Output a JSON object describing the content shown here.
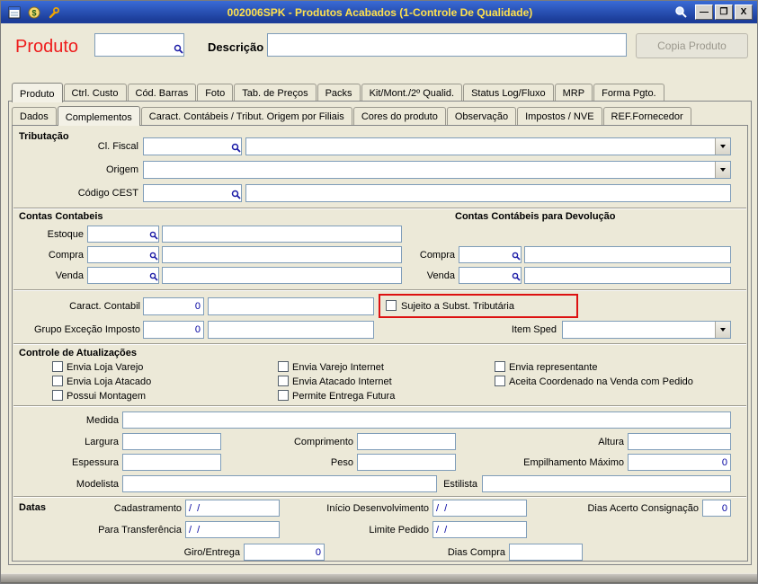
{
  "window": {
    "title": "002006SPK - Produtos Acabados (1-Controle De Qualidade)",
    "controls": {
      "minimize": "—",
      "maximize": "❐",
      "close": "X"
    }
  },
  "colors": {
    "titlebar_blue": "#1c3d99",
    "title_text_yellow": "#ffe14d",
    "produto_red": "#ee1c1c",
    "value_navy": "#0000a0",
    "annotation_red": "#dd1111"
  },
  "header": {
    "produto_label": "Produto",
    "produto_value": "",
    "descricao_label": "Descrição",
    "descricao_value": "",
    "copy_button": "Copia Produto"
  },
  "main_tabs": [
    "Produto",
    "Ctrl. Custo",
    "Cód. Barras",
    "Foto",
    "Tab. de Preços",
    "Packs",
    "Kit/Mont./2º Qualid.",
    "Status Log/Fluxo",
    "MRP",
    "Forma Pgto."
  ],
  "sub_tabs": [
    "Dados",
    "Complementos",
    "Caract. Contábeis / Tribut. Origem por Filiais",
    "Cores do produto",
    "Observação",
    "Impostos / NVE",
    "REF.Fornecedor"
  ],
  "tributacao": {
    "title": "Tributação",
    "cl_fiscal_label": "Cl. Fiscal",
    "cl_fiscal_code": "",
    "cl_fiscal_selected": "",
    "origem_label": "Origem",
    "origem_selected": "",
    "codigo_cest_label": "Código CEST",
    "codigo_cest_code": "",
    "codigo_cest_desc": ""
  },
  "contas": {
    "left_title": "Contas Contabeis",
    "right_title": "Contas Contábeis para Devolução",
    "estoque_label": "Estoque",
    "compra_label": "Compra",
    "venda_label": "Venda",
    "estoque_code": "",
    "estoque_desc": "",
    "compra_code": "",
    "compra_desc": "",
    "venda_code": "",
    "venda_desc": "",
    "dev_compra_label": "Compra",
    "dev_venda_label": "Venda",
    "dev_compra_code": "",
    "dev_compra_desc": "",
    "dev_venda_code": "",
    "dev_venda_desc": ""
  },
  "caract": {
    "caract_contabil_label": "Caract. Contabil",
    "caract_contabil_value": "0",
    "caract_contabil_desc": "",
    "sujeito_label": "Sujeito a Subst. Tributária",
    "grupo_excecao_label": "Grupo Exceção Imposto",
    "grupo_excecao_value": "0",
    "grupo_excecao_desc": "",
    "item_sped_label": "Item Sped",
    "item_sped_selected": ""
  },
  "controle": {
    "title": "Controle de Atualizações",
    "col1": [
      "Envia Loja Varejo",
      "Envia Loja Atacado",
      "Possui Montagem"
    ],
    "col2": [
      "Envia Varejo Internet",
      "Envia Atacado Internet",
      "Permite Entrega Futura"
    ],
    "col3": [
      "Envia representante",
      "Aceita Coordenado na Venda com Pedido"
    ]
  },
  "medidas": {
    "medida_label": "Medida",
    "medida_value": "",
    "largura_label": "Largura",
    "largura_value": "",
    "comprimento_label": "Comprimento",
    "comprimento_value": "",
    "altura_label": "Altura",
    "altura_value": "",
    "espessura_label": "Espessura",
    "espessura_value": "",
    "peso_label": "Peso",
    "peso_value": "",
    "empilhamento_label": "Empilhamento Máximo",
    "empilhamento_value": "0",
    "modelista_label": "Modelista",
    "modelista_value": "",
    "estilista_label": "Estilista",
    "estilista_value": ""
  },
  "datas": {
    "title": "Datas",
    "cadastramento_label": "Cadastramento",
    "cadastramento_value": "/  /",
    "inicio_label": "Início Desenvolvimento",
    "inicio_value": "/  /",
    "dias_acerto_label": "Dias Acerto Consignação",
    "dias_acerto_value": "0",
    "para_transferencia_label": "Para Transferência",
    "para_transferencia_value": "/  /",
    "limite_pedido_label": "Limite Pedido",
    "limite_pedido_value": "/  /",
    "giro_label": "Giro/Entrega",
    "giro_value": "0",
    "dias_compra_label": "Dias Compra",
    "dias_compra_value": ""
  }
}
